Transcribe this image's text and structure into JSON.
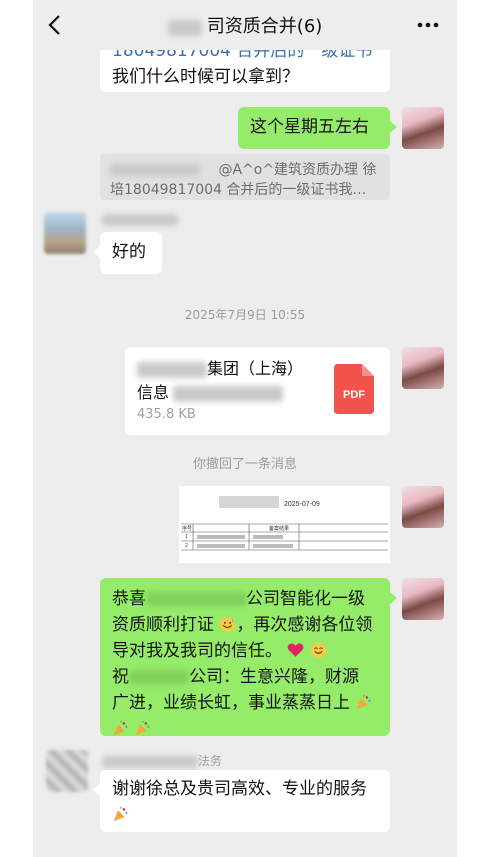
{
  "header": {
    "title_suffix": "司资质合并(6)"
  },
  "messages": {
    "m1": {
      "line1": "18049817004 合并后的一级证书",
      "line2": "我们什么时候可以拿到？"
    },
    "m2": {
      "text": "这个星期五左右"
    },
    "quote": {
      "line1": "@A^o^建筑资质办理 徐",
      "line2": "培18049817004 合并后的一级证书我…"
    },
    "m3": {
      "text": "好的"
    },
    "timestamp": "2025年7月9日 10:55",
    "file": {
      "name_line1": "集团（上海）",
      "name_line2": "信息",
      "size": "435.8 KB",
      "type_label": "PDF"
    },
    "recall_notice": "你撤回了一条消息",
    "doc_preview": {
      "heading": "备案结果",
      "year": "2025-07-09",
      "col_index": "序号",
      "row1_index": "1",
      "row2_index": "2"
    },
    "congrats": {
      "line1_a": "恭喜",
      "line1_b": "公司智能化一级",
      "line2": "资质顺利打证",
      "line2_b": "，再次感谢各位领",
      "line3": "导对我及我司的信任。",
      "line4_a": "祝",
      "line4_b": "公司：生意兴隆，财源",
      "line5": "广进，业绩长虹，事业蒸蒸日上"
    },
    "sender2_suffix": "法务",
    "m5": {
      "line1": "谢谢徐总及贵司高效、专业的服务"
    }
  },
  "icons": {
    "back": "chevron-left-icon",
    "more": "more-dots-icon",
    "pdf": "pdf-file-icon",
    "party": "party-popper-icon",
    "grin": "grinning-sweat-icon",
    "heart": "heart-icon",
    "smile": "smiling-face-icon"
  },
  "colors": {
    "chat_bg": "#ededed",
    "green_bubble": "#95ec69",
    "pdf_red": "#f0544c"
  }
}
